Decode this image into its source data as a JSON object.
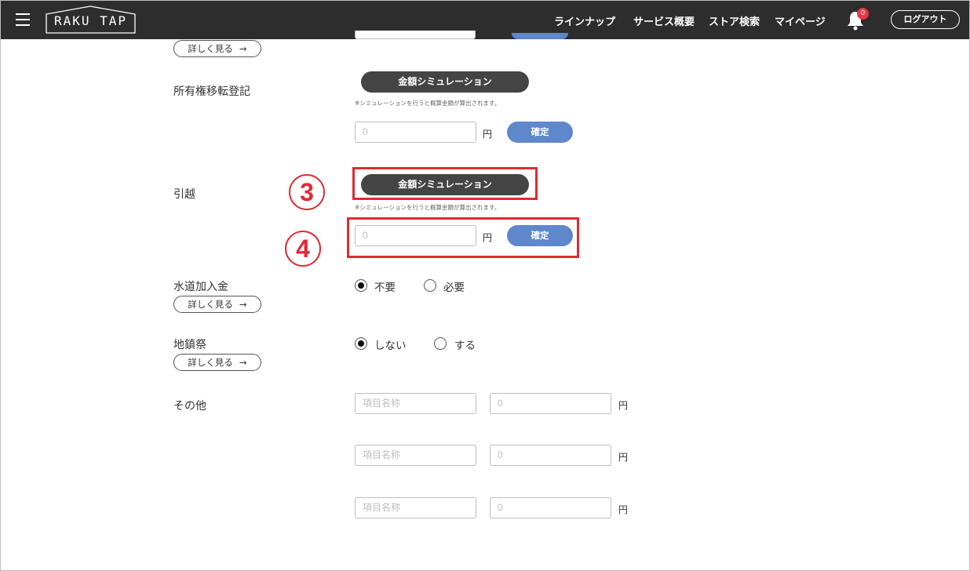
{
  "header": {
    "logo": "RAKU TAP",
    "nav": [
      "ラインナップ",
      "サービス概要",
      "ストア検索",
      "マイページ"
    ],
    "notification_count": "0",
    "logout_label": "ログアウト"
  },
  "common": {
    "detail_label": "詳しく見る",
    "detail_arrow": "→",
    "simulation_label": "金額シミュレーション",
    "simulation_note": "※シミュレーションを行うと概算金額が算出されます。",
    "amount_placeholder": "0",
    "yen": "円",
    "confirm_label": "確定",
    "item_name_placeholder": "項目名称"
  },
  "sections": {
    "ownership_transfer": {
      "label": "所有権移転登記"
    },
    "moving": {
      "label": "引越"
    },
    "water": {
      "label": "水道加入金",
      "options": [
        "不要",
        "必要"
      ],
      "selected": "不要"
    },
    "ground_ceremony": {
      "label": "地鎮祭",
      "options": [
        "しない",
        "する"
      ],
      "selected": "しない"
    },
    "other": {
      "label": "その他"
    }
  },
  "annotations": {
    "step3": "3",
    "step4": "4"
  },
  "colors": {
    "header_bg": "#2d2d2d",
    "confirm_blue": "#5f87cc",
    "highlight_red": "#e02a33",
    "badge_red": "#e53945"
  }
}
